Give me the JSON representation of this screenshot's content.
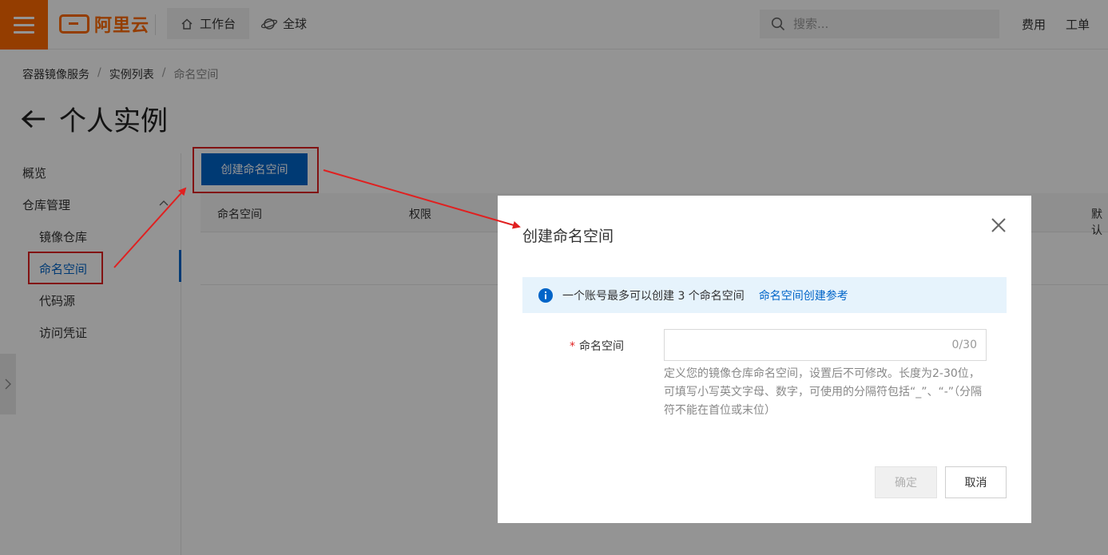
{
  "topbar": {
    "logo_text": "阿里云",
    "workbench_label": "工作台",
    "global_label": "全球",
    "search_placeholder": "搜索...",
    "links": [
      "费用",
      "工单"
    ]
  },
  "breadcrumb": [
    "容器镜像服务",
    "实例列表",
    "命名空间"
  ],
  "page_title": "个人实例",
  "sidebar": {
    "items": [
      {
        "label": "概览"
      },
      {
        "label": "仓库管理"
      },
      {
        "label": "镜像仓库"
      },
      {
        "label": "命名空间"
      },
      {
        "label": "代码源"
      },
      {
        "label": "访问凭证"
      }
    ]
  },
  "main": {
    "create_button": "创建命名空间",
    "columns": [
      "命名空间",
      "权限",
      "默认"
    ]
  },
  "dialog": {
    "title": "创建命名空间",
    "alert_text": "一个账号最多可以创建 3 个命名空间",
    "alert_link": "命名空间创建参考",
    "field_required_mark": "*",
    "field_label": "命名空间",
    "field_value": "",
    "field_counter": "0/30",
    "field_help": "定义您的镜像仓库命名空间，设置后不可修改。长度为2-30位，可填写小写英文字母、数字，可使用的分隔符包括“_”、“-”（分隔符不能在首位或末位）",
    "ok_label": "确定",
    "cancel_label": "取消"
  },
  "colors": {
    "brand_orange": "#ff6a00",
    "primary_blue": "#0064c8",
    "annotation_red": "#e02020",
    "alert_bg": "#e6f3fc"
  }
}
